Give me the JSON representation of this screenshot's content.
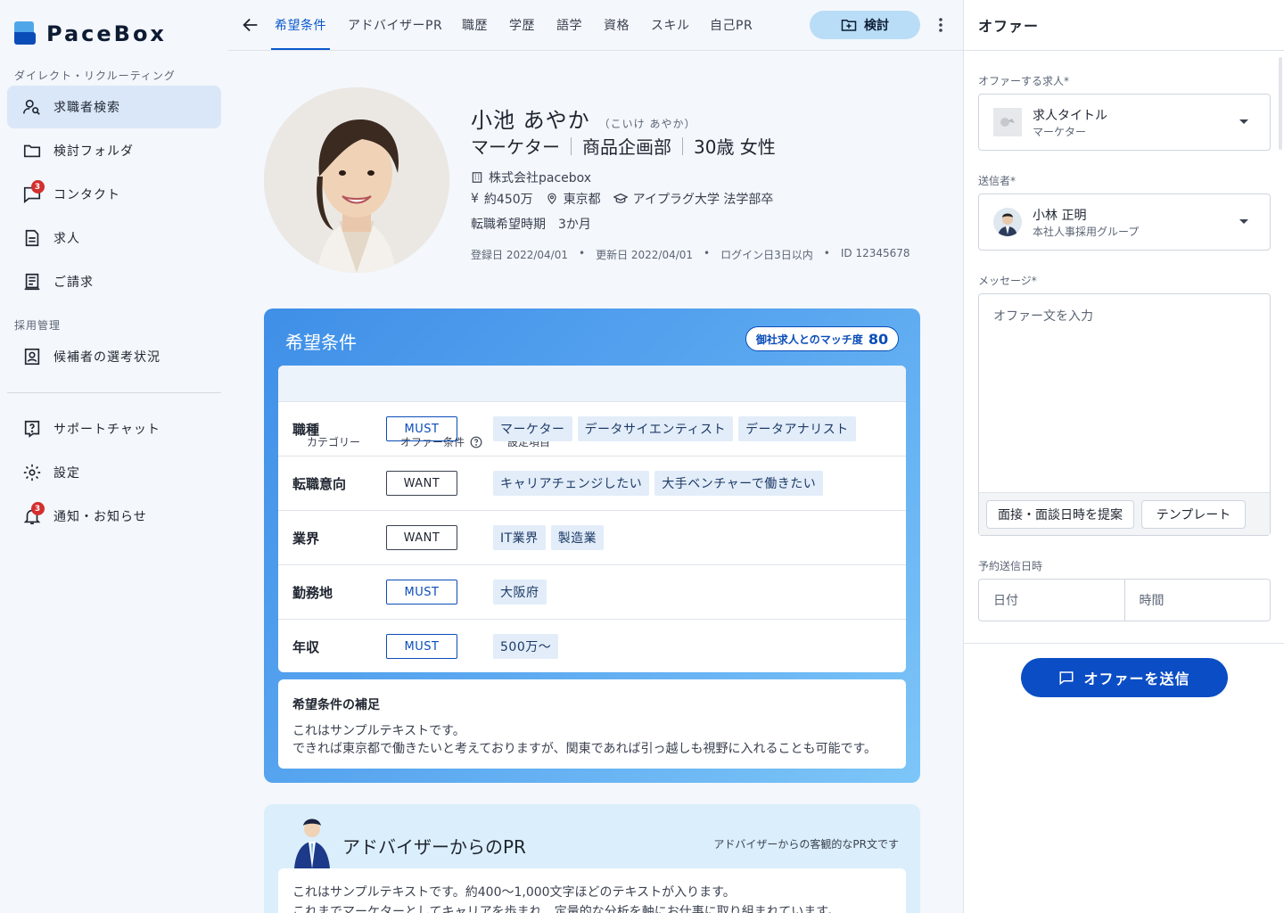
{
  "brand": {
    "name": "PaceBox"
  },
  "sidebar": {
    "section1": "ダイレクト・リクルーティング",
    "section2": "採用管理",
    "items": [
      {
        "label": "求職者検索",
        "icon": "person-search-icon"
      },
      {
        "label": "検討フォルダ",
        "icon": "folder-icon"
      },
      {
        "label": "コンタクト",
        "icon": "chat-icon",
        "badge": "3"
      },
      {
        "label": "求人",
        "icon": "document-icon"
      },
      {
        "label": "ご請求",
        "icon": "receipt-icon"
      },
      {
        "label": "候補者の選考状況",
        "icon": "badge-icon"
      },
      {
        "label": "サポートチャット",
        "icon": "help-chat-icon"
      },
      {
        "label": "設定",
        "icon": "gear-icon"
      },
      {
        "label": "通知・お知らせ",
        "icon": "bell-icon",
        "badge": "3"
      }
    ]
  },
  "tabs": [
    "希望条件",
    "アドバイザーPR",
    "職歴",
    "学歴",
    "語学",
    "資格",
    "スキル",
    "自己PR"
  ],
  "toolbar": {
    "consider": "検討"
  },
  "profile": {
    "name": "小池 あやか",
    "kana": "（こいけ あやか）",
    "job": "マーケター",
    "dept": "商品企画部",
    "agegender": "30歳 女性",
    "company": "株式会社pacebox",
    "salary": "約450万",
    "location": "東京都",
    "education": "アイプラグ大学 法学部卒",
    "timing": "転職希望時期　3か月",
    "registered": "登録日 2022/04/01",
    "updated": "更新日 2022/04/01",
    "login": "ログイン日3日以内",
    "id": "ID 12345678"
  },
  "conditions": {
    "title": "希望条件",
    "match_label": "御社求人とのマッチ度",
    "match_value": "80",
    "headers": [
      "カテゴリー",
      "オファー条件",
      "設定項目"
    ],
    "rows": [
      {
        "category": "職種",
        "level": "MUST",
        "items": [
          "マーケター",
          "データサイエンティスト",
          "データアナリスト"
        ]
      },
      {
        "category": "転職意向",
        "level": "WANT",
        "items": [
          "キャリアチェンジしたい",
          "大手ベンチャーで働きたい"
        ]
      },
      {
        "category": "業界",
        "level": "WANT",
        "items": [
          "IT業界",
          "製造業"
        ]
      },
      {
        "category": "勤務地",
        "level": "MUST",
        "items": [
          "大阪府"
        ]
      },
      {
        "category": "年収",
        "level": "MUST",
        "items": [
          "500万〜"
        ]
      }
    ],
    "supp_title": "希望条件の補足",
    "supp_line1": "これはサンプルテキストです。",
    "supp_line2": "できれば東京都で働きたいと考えておりますが、関東であれば引っ越しも視野に入れることも可能です。"
  },
  "advisor": {
    "title": "アドバイザーからのPR",
    "note": "アドバイザーからの客観的なPR文です",
    "line1": "これはサンプルテキストです。約400〜1,000文字ほどのテキストが入ります。",
    "line2": "これまでマーケターとしてキャリアを歩まれ、定量的な分析を軸にお仕事に取り組まれています。"
  },
  "offer": {
    "title": "オファー",
    "job_label": "オファーする求人*",
    "job_title": "求人タイトル",
    "job_sub": "マーケター",
    "sender_label": "送信者*",
    "sender_name": "小林 正明",
    "sender_dept": "本社人事採用グループ",
    "message_label": "メッセージ*",
    "message_placeholder": "オファー文を入力",
    "btn_interview": "面接・面談日時を提案",
    "btn_template": "テンプレート",
    "schedule_label": "予約送信日時",
    "date_placeholder": "日付",
    "time_placeholder": "時間",
    "send": "オファーを送信"
  },
  "colors": {
    "accent": "#0b59cc",
    "send": "#0b4dc4",
    "chip": "#e2edf9",
    "badge": "#d32f2f"
  }
}
